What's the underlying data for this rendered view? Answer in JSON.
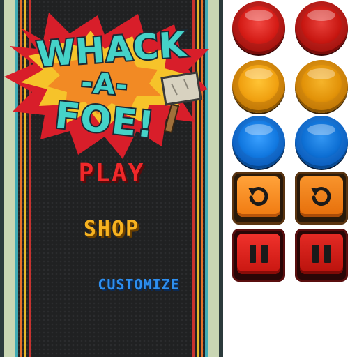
{
  "game": {
    "title_lines": [
      "WHACK",
      "-A-",
      "FOE!"
    ],
    "menu": {
      "play": "PLAY",
      "shop": "SHOP",
      "customize": "CUSTOMIZE"
    }
  },
  "colors": {
    "play": "#f0282a",
    "shop": "#f7b320",
    "customize": "#2e8ff0",
    "logo_text": "#45d2c8",
    "burst": "#d81e2a"
  },
  "sprites": {
    "round_buttons": [
      {
        "color": "red",
        "count": 2
      },
      {
        "color": "orange",
        "count": 2
      },
      {
        "color": "blue",
        "count": 2
      }
    ],
    "square_buttons": [
      {
        "icon": "replay-icon",
        "count": 2
      },
      {
        "icon": "pause-icon",
        "count": 2
      }
    ]
  }
}
